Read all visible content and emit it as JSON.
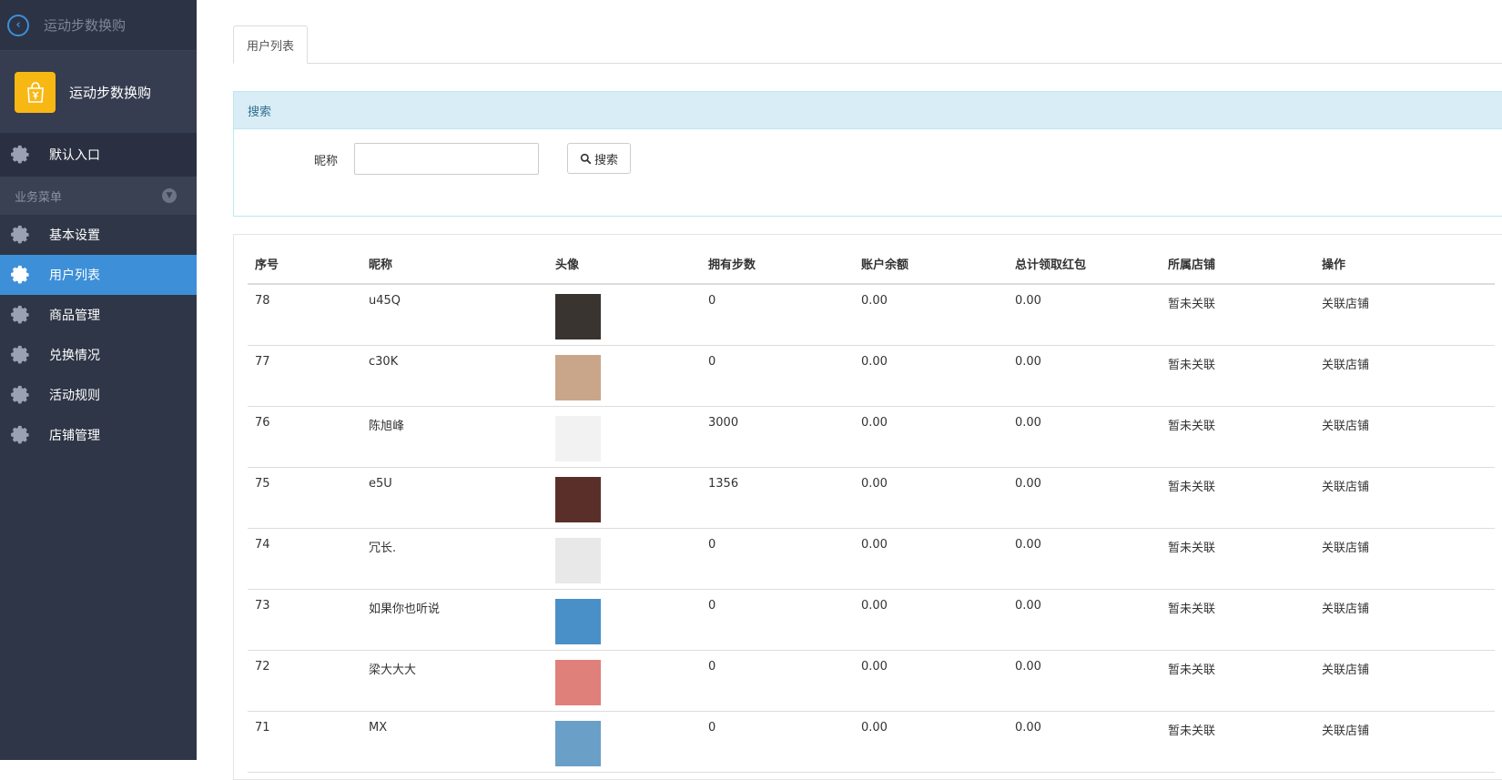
{
  "topbar": {
    "title": "运动步数换购"
  },
  "app": {
    "name": "运动步数换购",
    "logo_icon": "shopping-bag-yen-icon"
  },
  "sidebar": {
    "default_entry": "默认入口",
    "group_label": "业务菜单",
    "items": [
      {
        "label": "基本设置",
        "active": false
      },
      {
        "label": "用户列表",
        "active": true
      },
      {
        "label": "商品管理",
        "active": false
      },
      {
        "label": "兑换情况",
        "active": false
      },
      {
        "label": "活动规则",
        "active": false
      },
      {
        "label": "店铺管理",
        "active": false
      }
    ]
  },
  "tabs": [
    {
      "label": "用户列表"
    }
  ],
  "search_panel": {
    "title": "搜索",
    "nickname_label": "昵称",
    "nickname_value": "",
    "button_label": "搜索"
  },
  "table": {
    "headers": [
      "序号",
      "昵称",
      "头像",
      "拥有步数",
      "账户余额",
      "总计领取红包",
      "所属店铺",
      "操作"
    ],
    "rows": [
      {
        "id": "78",
        "nickname": "u45Q",
        "steps": "0",
        "balance": "0.00",
        "redpack": "0.00",
        "shop": "暂未关联",
        "action": "关联店铺",
        "avatar_color": "#3a3430"
      },
      {
        "id": "77",
        "nickname": "c30K",
        "steps": "0",
        "balance": "0.00",
        "redpack": "0.00",
        "shop": "暂未关联",
        "action": "关联店铺",
        "avatar_color": "#c9a68a"
      },
      {
        "id": "76",
        "nickname": "陈旭峰",
        "steps": "3000",
        "balance": "0.00",
        "redpack": "0.00",
        "shop": "暂未关联",
        "action": "关联店铺",
        "avatar_color": "#f2f2f2"
      },
      {
        "id": "75",
        "nickname": "e5U",
        "steps": "1356",
        "balance": "0.00",
        "redpack": "0.00",
        "shop": "暂未关联",
        "action": "关联店铺",
        "avatar_color": "#5a2f2a"
      },
      {
        "id": "74",
        "nickname": "冗长.",
        "steps": "0",
        "balance": "0.00",
        "redpack": "0.00",
        "shop": "暂未关联",
        "action": "关联店铺",
        "avatar_color": "#e8e8e8"
      },
      {
        "id": "73",
        "nickname": "如果你也听说",
        "steps": "0",
        "balance": "0.00",
        "redpack": "0.00",
        "shop": "暂未关联",
        "action": "关联店铺",
        "avatar_color": "#4a90c8"
      },
      {
        "id": "72",
        "nickname": "梁大大大",
        "steps": "0",
        "balance": "0.00",
        "redpack": "0.00",
        "shop": "暂未关联",
        "action": "关联店铺",
        "avatar_color": "#e0807a"
      },
      {
        "id": "71",
        "nickname": "MX",
        "steps": "0",
        "balance": "0.00",
        "redpack": "0.00",
        "shop": "暂未关联",
        "action": "关联店铺",
        "avatar_color": "#6a9fc8"
      }
    ]
  },
  "colors": {
    "sidebar_bg": "#2f3647",
    "active_bg": "#3d8fd8",
    "logo_bg": "#f8b814",
    "panel_head_bg": "#d9edf7"
  }
}
